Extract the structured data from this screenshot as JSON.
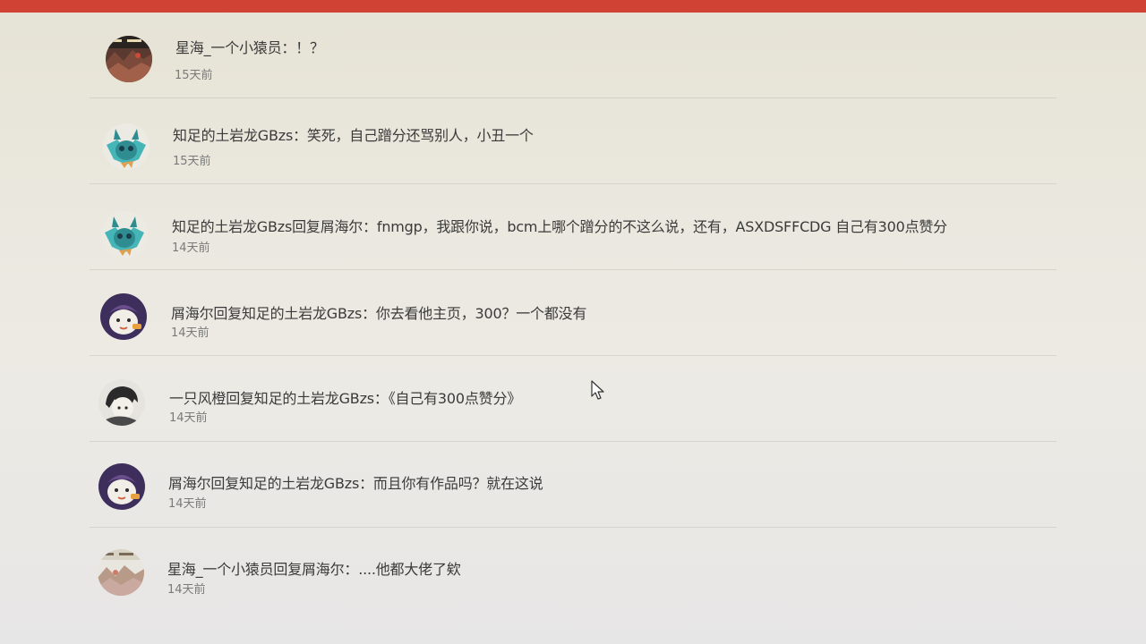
{
  "comments": [
    {
      "author": "星海_一个小猿员",
      "text": "星海_一个小猿员：！？",
      "time": "15天前",
      "avatar_icon": "landscape-avatar-icon"
    },
    {
      "author": "知足的土岩龙GBzs",
      "text": "知足的土岩龙GBzs：笑死，自己蹭分还骂别人，小丑一个",
      "time": "15天前",
      "avatar_icon": "teal-creature-avatar-icon"
    },
    {
      "author": "知足的土岩龙GBzs",
      "text": "知足的土岩龙GBzs回复屑海尔：fnmgp，我跟你说，bcm上哪个蹭分的不这么说，还有，ASXDSFFCDG 自己有300点赞分",
      "time": "14天前",
      "avatar_icon": "teal-creature-avatar-icon"
    },
    {
      "author": "屑海尔",
      "text": "屑海尔回复知足的土岩龙GBzs：你去看他主页，300？一个都没有",
      "time": "14天前",
      "avatar_icon": "purple-character-avatar-icon"
    },
    {
      "author": "一只风橙",
      "text": "一只风橙回复知足的土岩龙GBzs：《自己有300点赞分》",
      "time": "14天前",
      "avatar_icon": "sketch-character-avatar-icon"
    },
    {
      "author": "屑海尔",
      "text": "屑海尔回复知足的土岩龙GBzs：而且你有作品吗？就在这说",
      "time": "14天前",
      "avatar_icon": "purple-character-avatar-icon"
    },
    {
      "author": "星海_一个小猿员",
      "text": "星海_一个小猿员回复屑海尔：....他都大佬了欸",
      "time": "14天前",
      "avatar_icon": "landscape-avatar-icon"
    }
  ],
  "colors": {
    "top_bar": "#cf4234",
    "text": "#3a3a3a",
    "time": "#7a7a7a",
    "teal_avatar": "#45b5b8",
    "purple_avatar": "#3e2e5c"
  }
}
